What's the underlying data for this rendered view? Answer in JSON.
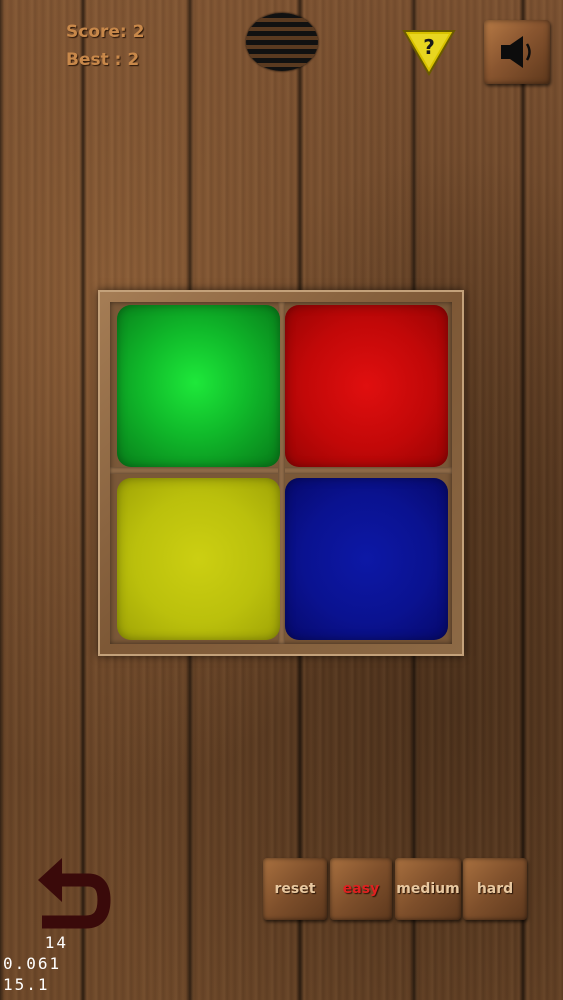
{
  "header": {
    "score_text": "Score: 2",
    "best_text": "Best : 2",
    "menu_icon": "striped-ball-icon",
    "help_icon": "help-triangle-icon",
    "help_glyph": "?",
    "sound_icon": "speaker-icon"
  },
  "board": {
    "tiles": [
      {
        "color": "green",
        "hex": "#10b92a"
      },
      {
        "color": "red",
        "hex": "#c20808"
      },
      {
        "color": "yellow",
        "hex": "#bbc00c"
      },
      {
        "color": "blue",
        "hex": "#0a1290"
      }
    ]
  },
  "controls": {
    "undo_icon": "undo-arrow-icon",
    "buttons": [
      {
        "label": "reset"
      },
      {
        "label": "easy",
        "selected": true
      },
      {
        "label": "medium"
      },
      {
        "label": "hard"
      }
    ]
  },
  "stats": {
    "line1": "14",
    "line2": "0.061",
    "line3": "15.1"
  },
  "colors": {
    "score_text": "#c8884a",
    "selected_difficulty": "#e02020",
    "button_text": "#e8c8a0",
    "help_triangle": "#d8c200"
  }
}
